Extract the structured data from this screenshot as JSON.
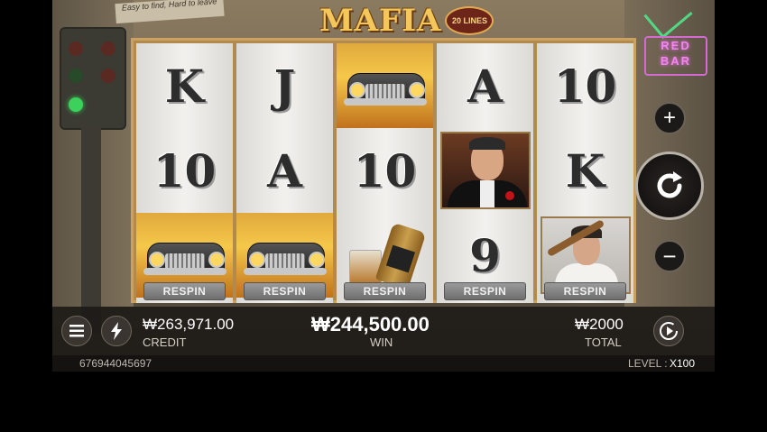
{
  "game": {
    "title": "MAFIA",
    "lines_badge": "20 LINES",
    "background_sign": "Easy to find, Hard to leave",
    "neon_sign": "RED BAR"
  },
  "reels": [
    {
      "symbols": [
        "K",
        "10",
        "car"
      ],
      "respin_label": "RESPIN"
    },
    {
      "symbols": [
        "J",
        "A",
        "car"
      ],
      "respin_label": "RESPIN"
    },
    {
      "symbols": [
        "car",
        "10",
        "whiskey"
      ],
      "respin_label": "RESPIN"
    },
    {
      "symbols": [
        "A",
        "godfather",
        "9"
      ],
      "respin_label": "RESPIN"
    },
    {
      "symbols": [
        "10",
        "K",
        "thug"
      ],
      "respin_label": "RESPIN"
    }
  ],
  "controls": {
    "plus_icon": "plus-icon",
    "spin_icon": "refresh-icon",
    "minus_icon": "minus-icon",
    "menu_icon": "hamburger-icon",
    "turbo_icon": "lightning-icon",
    "autoplay_icon": "play-circle-icon"
  },
  "bar": {
    "credit_value": "₩263,971.00",
    "credit_label": "CREDIT",
    "win_value": "₩244,500.00",
    "win_label": "WIN",
    "total_value": "₩2000",
    "total_label": "TOTAL"
  },
  "footer": {
    "round_id": "676944045697",
    "level_label": "LEVEL :",
    "level_value": "X100"
  },
  "colors": {
    "title_gold": "#f4c75a",
    "fire": "#f5c84a",
    "reel_frame": "#b28a4d",
    "bar_bg": "#181614"
  }
}
